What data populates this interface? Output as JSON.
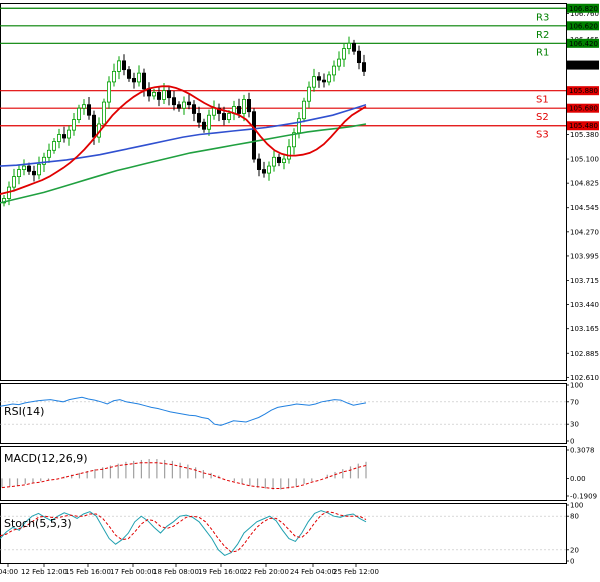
{
  "chart_data": {
    "type": "candlestick",
    "main": {
      "y_ticks": [
        "106.820",
        "106.760",
        "106.465",
        "106.172",
        "105.880",
        "105.680",
        "105.480",
        "105.380",
        "105.100",
        "104.825",
        "104.545",
        "104.270",
        "103.995",
        "103.715",
        "103.440",
        "103.165",
        "102.885",
        "102.610"
      ],
      "ylim": [
        102.58,
        106.88
      ],
      "current_price": "106.172",
      "levels": [
        {
          "name": "R3",
          "value": 106.82,
          "label": "106.820",
          "color": "#008000"
        },
        {
          "name": "R2",
          "value": 106.62,
          "label": "106.620",
          "color": "#008000"
        },
        {
          "name": "R1",
          "value": 106.42,
          "label": "106.420",
          "color": "#008000"
        },
        {
          "name": "S1",
          "value": 105.88,
          "label": "105.880",
          "color": "#e00000"
        },
        {
          "name": "S2",
          "value": 105.68,
          "label": "105.680",
          "color": "#e00000"
        },
        {
          "name": "S3",
          "value": 105.48,
          "label": "105.480",
          "color": "#e00000"
        }
      ],
      "candles_close": [
        104.65,
        104.78,
        104.9,
        104.98,
        105.02,
        104.96,
        104.92,
        105.04,
        105.12,
        105.2,
        105.3,
        105.38,
        105.34,
        105.43,
        105.55,
        105.68,
        105.72,
        105.6,
        105.35,
        105.5,
        105.75,
        105.98,
        106.1,
        106.22,
        106.12,
        106.02,
        105.98,
        106.08,
        105.9,
        105.82,
        105.86,
        105.78,
        105.88,
        105.8,
        105.72,
        105.68,
        105.75,
        105.72,
        105.62,
        105.52,
        105.44,
        105.6,
        105.68,
        105.62,
        105.55,
        105.62,
        105.7,
        105.62,
        105.78,
        105.64,
        105.1,
        104.98,
        104.94,
        105.02,
        105.12,
        105.06,
        105.1,
        105.24,
        105.4,
        105.56,
        105.76,
        105.92,
        106.04,
        106.0,
        105.98,
        106.06,
        106.16,
        106.24,
        106.36,
        106.42,
        106.33,
        106.2,
        106.1
      ],
      "sma_fast": [
        104.7,
        104.72,
        104.74,
        104.77,
        104.8,
        104.83,
        104.86,
        104.9,
        104.95,
        105.0,
        105.06,
        105.13,
        105.21,
        105.3,
        105.4,
        105.5,
        105.6,
        105.68,
        105.75,
        105.81,
        105.86,
        105.9,
        105.92,
        105.93,
        105.93,
        105.91,
        105.88,
        105.84,
        105.79,
        105.74,
        105.7,
        105.67,
        105.65,
        105.63,
        105.6,
        105.55,
        105.46,
        105.36,
        105.27,
        105.2,
        105.16,
        105.14,
        105.14,
        105.15,
        105.17,
        105.21,
        105.27,
        105.35,
        105.44,
        105.53,
        105.6,
        105.65,
        105.7
      ],
      "sma_mid": [
        105.02,
        105.03,
        105.05,
        105.07,
        105.09,
        105.12,
        105.15,
        105.19,
        105.23,
        105.27,
        105.31,
        105.35,
        105.38,
        105.4,
        105.42,
        105.44,
        105.46,
        105.49,
        105.52,
        105.56,
        105.6,
        105.66,
        105.72
      ],
      "sma_slow": [
        104.6,
        104.64,
        104.68,
        104.72,
        104.77,
        104.82,
        104.87,
        104.92,
        104.97,
        105.01,
        105.05,
        105.09,
        105.13,
        105.17,
        105.2,
        105.23,
        105.26,
        105.29,
        105.32,
        105.35,
        105.38,
        105.41,
        105.43,
        105.45,
        105.47,
        105.5
      ]
    },
    "rsi": {
      "label": "RSI(14)",
      "ticks": [
        "100",
        "70",
        "30",
        "0"
      ],
      "ylim": [
        0,
        100
      ],
      "values": [
        62,
        64,
        66,
        65,
        68,
        70,
        72,
        73,
        74,
        72,
        70,
        74,
        76,
        78,
        75,
        73,
        70,
        66,
        72,
        74,
        70,
        68,
        66,
        63,
        60,
        58,
        55,
        52,
        50,
        48,
        46,
        45,
        42,
        40,
        30,
        28,
        32,
        36,
        35,
        34,
        38,
        42,
        48,
        55,
        60,
        62,
        64,
        66,
        65,
        64,
        66,
        70,
        72,
        74,
        73,
        68,
        64,
        66,
        68
      ]
    },
    "macd": {
      "label": "MACD(12,26,9)",
      "ticks": [
        "0.3078",
        "0.00",
        "-0.1909"
      ],
      "ylim": [
        -0.1909,
        0.3078
      ],
      "histogram": [
        -0.1,
        -0.09,
        -0.08,
        -0.06,
        -0.05,
        -0.03,
        -0.02,
        0.0,
        0.02,
        0.04,
        0.06,
        0.08,
        0.1,
        0.12,
        0.14,
        0.16,
        0.18,
        0.19,
        0.2,
        0.21,
        0.21,
        0.2,
        0.19,
        0.17,
        0.15,
        0.12,
        0.09,
        0.06,
        0.03,
        0.0,
        -0.03,
        -0.06,
        -0.08,
        -0.1,
        -0.11,
        -0.12,
        -0.12,
        -0.11,
        -0.09,
        -0.06,
        -0.03,
        0.0,
        0.04,
        0.07,
        0.1,
        0.13,
        0.16,
        0.18
      ],
      "signal": [
        -0.1,
        -0.09,
        -0.08,
        -0.07,
        -0.05,
        -0.04,
        -0.02,
        -0.01,
        0.01,
        0.03,
        0.05,
        0.07,
        0.09,
        0.1,
        0.12,
        0.14,
        0.15,
        0.16,
        0.17,
        0.17,
        0.17,
        0.16,
        0.15,
        0.13,
        0.11,
        0.09,
        0.06,
        0.04,
        0.01,
        -0.02,
        -0.04,
        -0.06,
        -0.08,
        -0.09,
        -0.1,
        -0.11,
        -0.11,
        -0.1,
        -0.09,
        -0.07,
        -0.04,
        -0.02,
        0.01,
        0.04,
        0.07,
        0.09,
        0.12,
        0.14
      ]
    },
    "stoch": {
      "label": "Stoch(5,5,3)",
      "ticks": [
        "100",
        "80",
        "20",
        "0"
      ],
      "ylim": [
        0,
        100
      ],
      "k": [
        40,
        52,
        60,
        55,
        70,
        80,
        85,
        78,
        72,
        80,
        86,
        82,
        76,
        84,
        88,
        80,
        60,
        40,
        30,
        38,
        50,
        70,
        80,
        72,
        60,
        50,
        62,
        70,
        80,
        82,
        78,
        70,
        55,
        40,
        20,
        10,
        15,
        30,
        50,
        60,
        70,
        75,
        80,
        72,
        55,
        40,
        35,
        50,
        70,
        85,
        90,
        86,
        80,
        78,
        82,
        84,
        76,
        70
      ],
      "d": [
        45,
        48,
        55,
        58,
        62,
        70,
        78,
        80,
        78,
        77,
        80,
        82,
        80,
        80,
        84,
        84,
        76,
        62,
        46,
        38,
        40,
        52,
        66,
        74,
        72,
        62,
        58,
        62,
        70,
        78,
        80,
        78,
        70,
        56,
        40,
        26,
        16,
        18,
        30,
        46,
        60,
        70,
        76,
        76,
        68,
        56,
        44,
        42,
        52,
        68,
        82,
        88,
        86,
        82,
        80,
        80,
        80,
        74
      ]
    },
    "x_ticks": [
      "04:00",
      "12 Feb 12:00",
      "15 Feb 16:00",
      "17 Feb 00:00",
      "18 Feb 08:00",
      "19 Feb 16:00",
      "22 Feb 20:00",
      "24 Feb 04:00",
      "25 Feb 12:00"
    ]
  },
  "colors": {
    "bull": "#00a000",
    "bear": "#000000",
    "sma_fast": "#e00000",
    "sma_mid": "#3050d0",
    "sma_slow": "#20a040",
    "rsi": "#2080e0",
    "macd_signal": "#e00000",
    "stoch_k": "#20a0b0",
    "stoch_d": "#e00000",
    "current_price_box": "#000000"
  }
}
